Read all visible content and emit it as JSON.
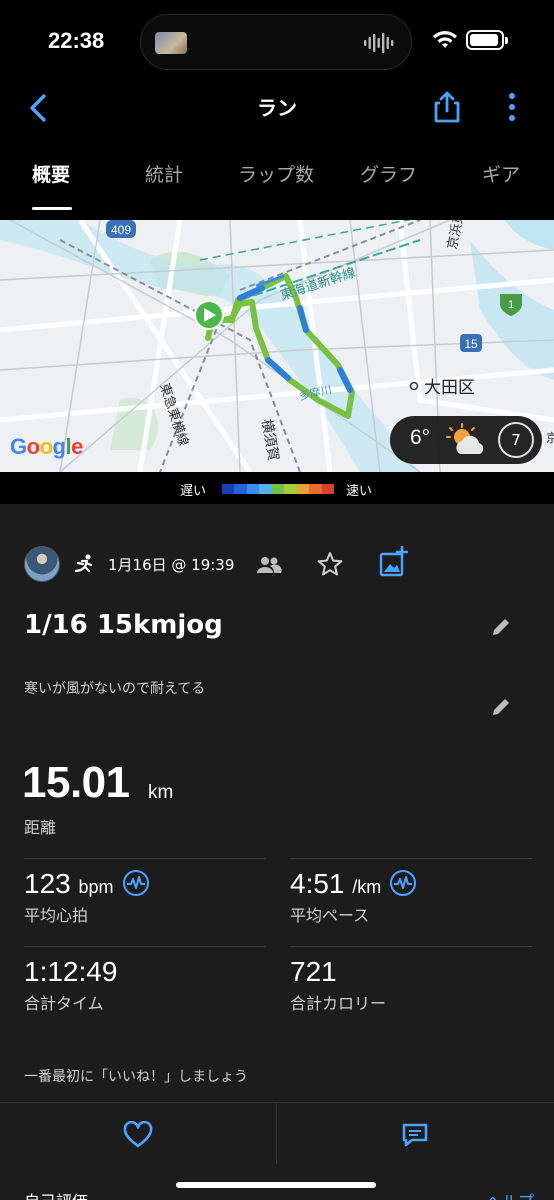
{
  "status_bar": {
    "time": "22:38"
  },
  "nav": {
    "title": "ラン"
  },
  "tabs": [
    {
      "label": "概要",
      "active": true
    },
    {
      "label": "統計",
      "active": false
    },
    {
      "label": "ラップ数",
      "active": false
    },
    {
      "label": "グラフ",
      "active": false
    },
    {
      "label": "ギア",
      "active": false
    }
  ],
  "map": {
    "labels": {
      "route_409": "409",
      "shinkansen": "東海道新幹線",
      "keihin": "京浜東北線",
      "ota": "大田区",
      "tamagawa": "多摩川",
      "toyoko": "東急東横線",
      "yokosuka": "横須賀",
      "route_15": "15",
      "route_1": "1",
      "edge_right": "京"
    },
    "weather": {
      "temp": "6°",
      "wind": "7"
    },
    "attribution": "Google"
  },
  "legend": {
    "slow": "遅い",
    "fast": "速い",
    "colors": [
      "#1b3fae",
      "#2264d8",
      "#3a8ee8",
      "#56b0ee",
      "#6cc24a",
      "#a7cc3a",
      "#e8a13a",
      "#e86a2e",
      "#d8402a"
    ]
  },
  "activity": {
    "date": "1月16日 @ 19:39",
    "title": "1/16 15kmjog",
    "note": "寒いが風がないので耐えてる",
    "distance": {
      "value": "15.01",
      "unit": "km",
      "label": "距離"
    },
    "heart_rate": {
      "value": "123",
      "unit": "bpm",
      "label": "平均心拍"
    },
    "pace": {
      "value": "4:51",
      "unit": "/km",
      "label": "平均ペース"
    },
    "total_time": {
      "value": "1:12:49",
      "label": "合計タイム"
    },
    "calories": {
      "value": "721",
      "label": "合計カロリー"
    },
    "like_prompt": "一番最初に「いいね！」しましょう"
  },
  "peek": {
    "left": "自己評価",
    "right": "ヘルプ"
  },
  "colors": {
    "accent": "#4aa3ff",
    "route": "#7ac143",
    "background": "#000000",
    "card": "#1c1c1c"
  }
}
